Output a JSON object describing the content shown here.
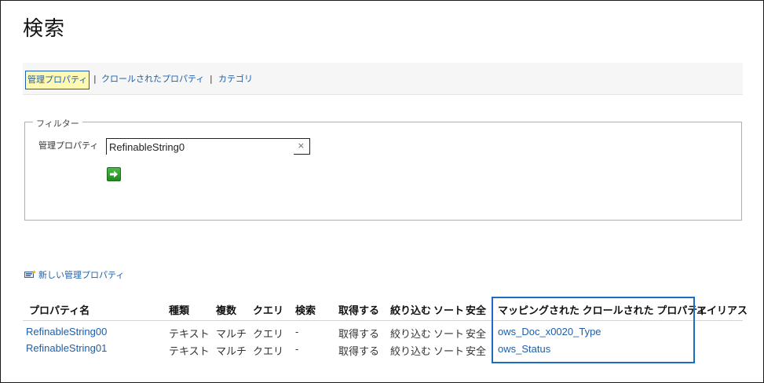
{
  "page": {
    "title": "検索"
  },
  "nav": {
    "items": [
      {
        "label": "管理プロパティ",
        "active": true
      },
      {
        "label": "クロールされたプロパティ",
        "active": false
      },
      {
        "label": "カテゴリ",
        "active": false
      }
    ],
    "separator": "|"
  },
  "filter": {
    "legend": "フィルター",
    "label": "管理プロパティ",
    "value": "RefinableString0",
    "clear_glyph": "×"
  },
  "new_property": {
    "label": "新しい管理プロパティ"
  },
  "table": {
    "headers": [
      "プロパティ名",
      "種類",
      "複数",
      "クエリ",
      "検索",
      "取得する",
      "絞り込む",
      "ソート",
      "安全",
      "マッピングされた クロールされた プロパティ",
      "エイリアス"
    ],
    "rows": [
      {
        "name": "RefinableString00",
        "type": "テキスト",
        "multi": "マルチ",
        "query": "クエリ",
        "search": "-",
        "retrieve": "取得する",
        "refine": "絞り込む",
        "sort": "ソート",
        "safe": "安全",
        "mapped": "ows_Doc_x0020_Type",
        "alias": ""
      },
      {
        "name": "RefinableString01",
        "type": "テキスト",
        "multi": "マルチ",
        "query": "クエリ",
        "search": "-",
        "retrieve": "取得する",
        "refine": "絞り込む",
        "sort": "ソート",
        "safe": "安全",
        "mapped": "ows_Status",
        "alias": ""
      }
    ]
  },
  "colors": {
    "link": "#1e5fa8",
    "highlight": "#1b6cc4",
    "active_nav_bg": "#fff9b3"
  }
}
